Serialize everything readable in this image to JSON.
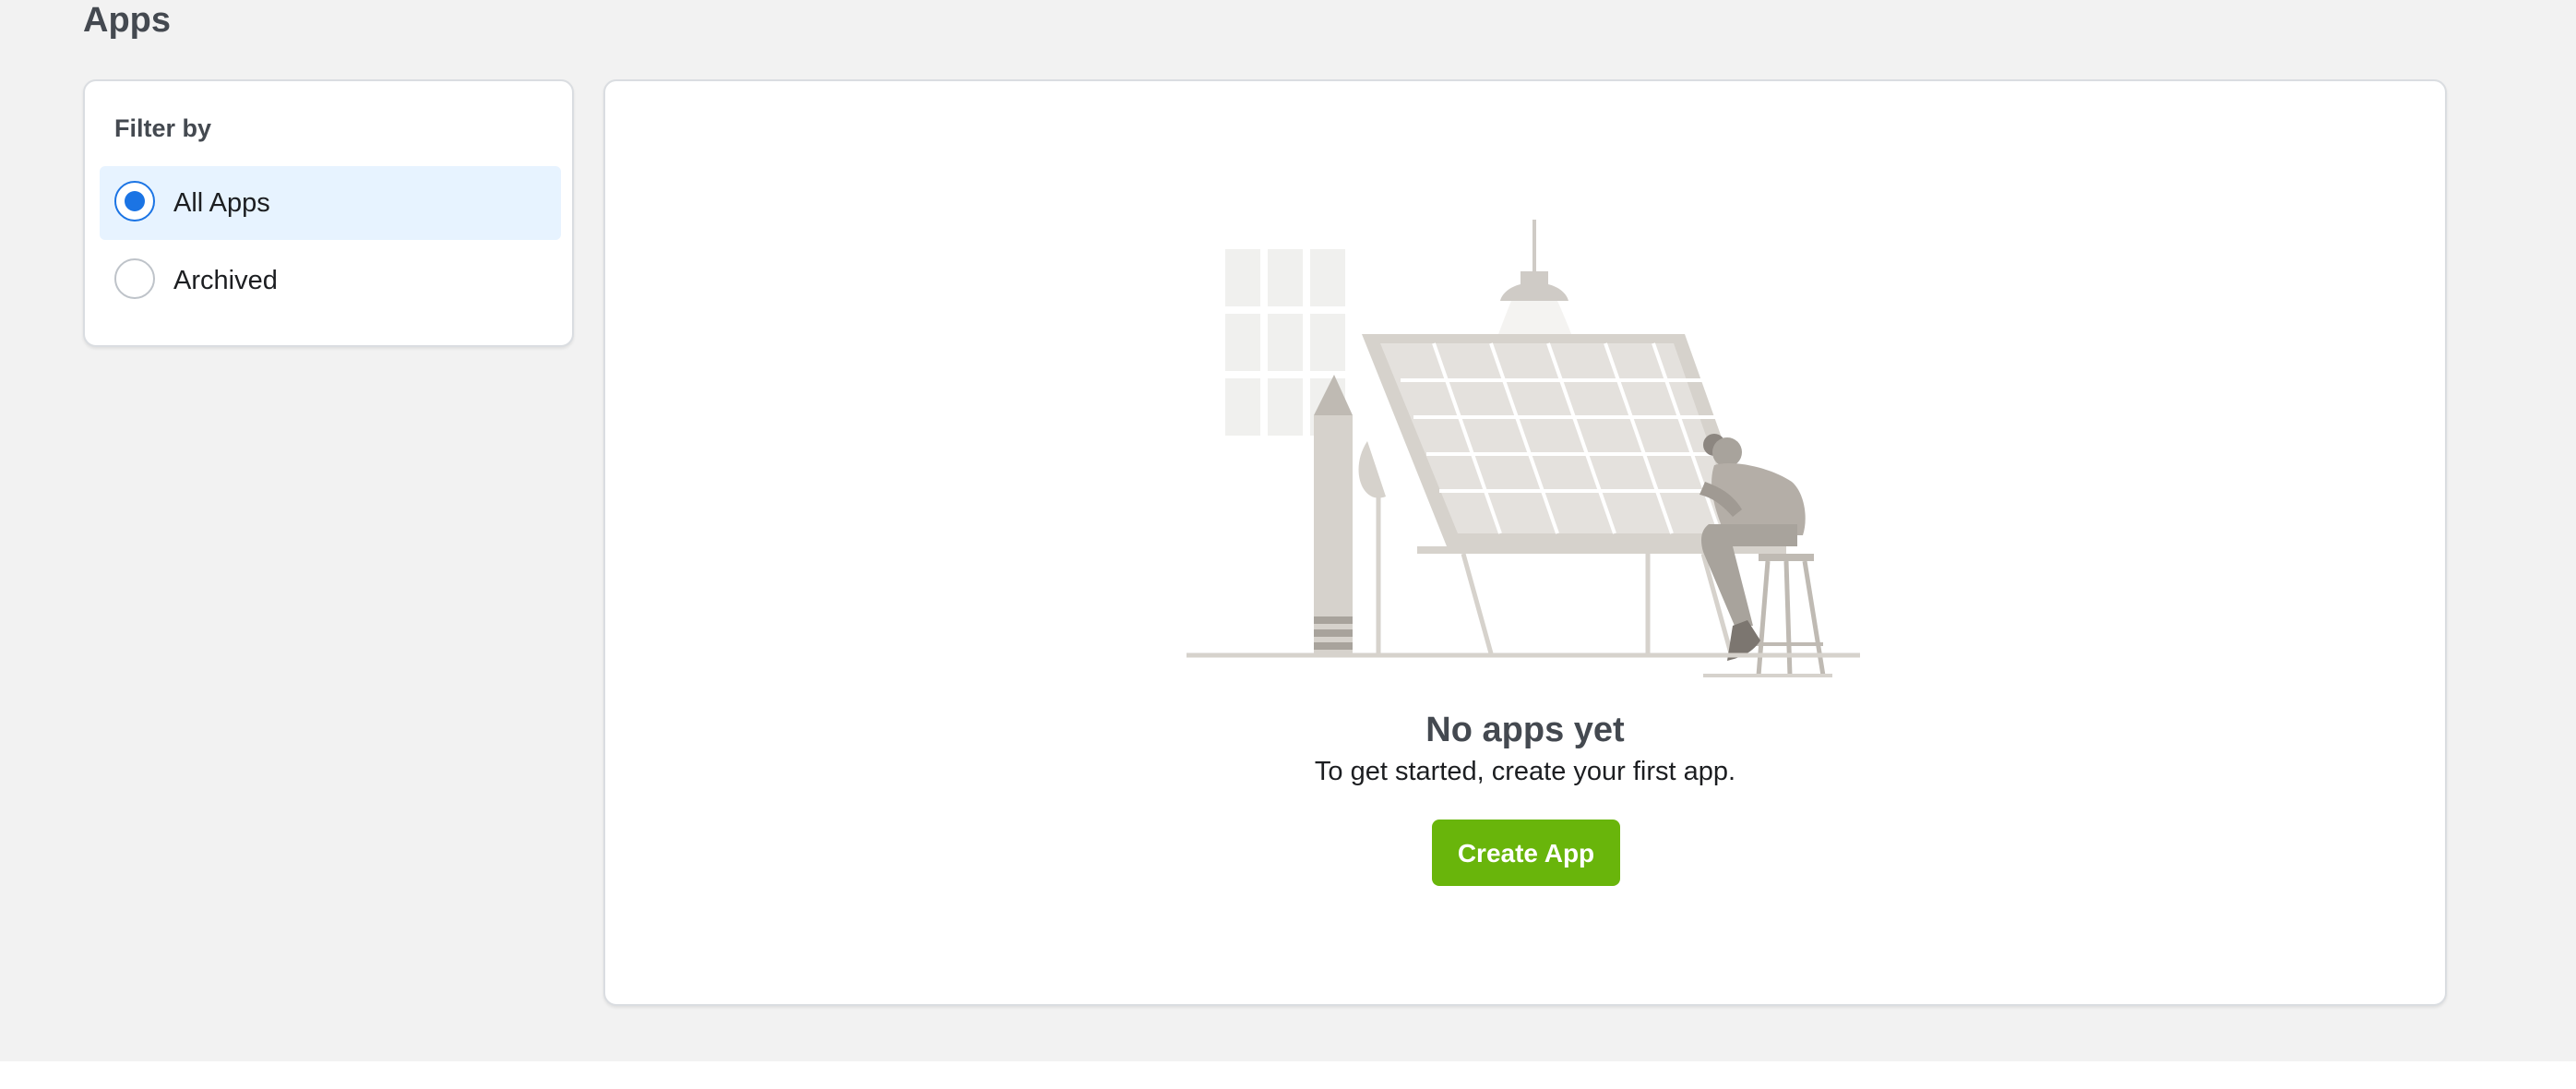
{
  "page": {
    "title": "Apps"
  },
  "filter": {
    "heading": "Filter by",
    "options": [
      {
        "label": "All Apps",
        "selected": true
      },
      {
        "label": "Archived",
        "selected": false
      }
    ]
  },
  "empty_state": {
    "title": "No apps yet",
    "subtitle": "To get started, create your first app.",
    "button_label": "Create App",
    "illustration": "person-at-drafting-table-illustration"
  },
  "colors": {
    "background": "#f2f2f2",
    "selected_option_bg": "#e7f3ff",
    "radio_selected": "#1b74e4",
    "button": "#69b50b"
  }
}
